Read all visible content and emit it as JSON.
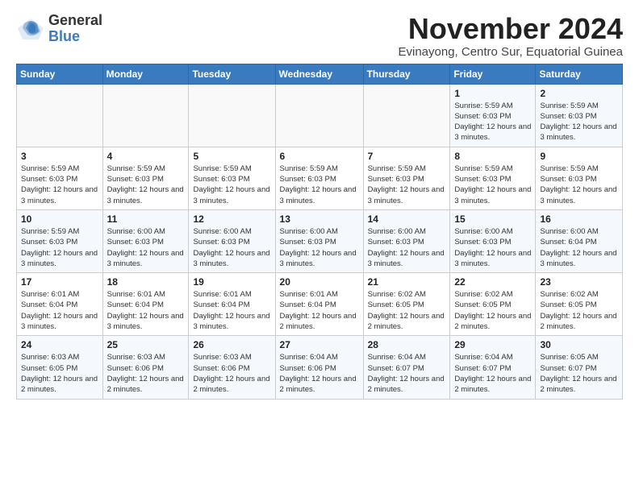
{
  "logo": {
    "general": "General",
    "blue": "Blue"
  },
  "header": {
    "month": "November 2024",
    "location": "Evinayong, Centro Sur, Equatorial Guinea"
  },
  "days_of_week": [
    "Sunday",
    "Monday",
    "Tuesday",
    "Wednesday",
    "Thursday",
    "Friday",
    "Saturday"
  ],
  "weeks": [
    [
      {
        "day": "",
        "info": ""
      },
      {
        "day": "",
        "info": ""
      },
      {
        "day": "",
        "info": ""
      },
      {
        "day": "",
        "info": ""
      },
      {
        "day": "",
        "info": ""
      },
      {
        "day": "1",
        "info": "Sunrise: 5:59 AM\nSunset: 6:03 PM\nDaylight: 12 hours and 3 minutes."
      },
      {
        "day": "2",
        "info": "Sunrise: 5:59 AM\nSunset: 6:03 PM\nDaylight: 12 hours and 3 minutes."
      }
    ],
    [
      {
        "day": "3",
        "info": "Sunrise: 5:59 AM\nSunset: 6:03 PM\nDaylight: 12 hours and 3 minutes."
      },
      {
        "day": "4",
        "info": "Sunrise: 5:59 AM\nSunset: 6:03 PM\nDaylight: 12 hours and 3 minutes."
      },
      {
        "day": "5",
        "info": "Sunrise: 5:59 AM\nSunset: 6:03 PM\nDaylight: 12 hours and 3 minutes."
      },
      {
        "day": "6",
        "info": "Sunrise: 5:59 AM\nSunset: 6:03 PM\nDaylight: 12 hours and 3 minutes."
      },
      {
        "day": "7",
        "info": "Sunrise: 5:59 AM\nSunset: 6:03 PM\nDaylight: 12 hours and 3 minutes."
      },
      {
        "day": "8",
        "info": "Sunrise: 5:59 AM\nSunset: 6:03 PM\nDaylight: 12 hours and 3 minutes."
      },
      {
        "day": "9",
        "info": "Sunrise: 5:59 AM\nSunset: 6:03 PM\nDaylight: 12 hours and 3 minutes."
      }
    ],
    [
      {
        "day": "10",
        "info": "Sunrise: 5:59 AM\nSunset: 6:03 PM\nDaylight: 12 hours and 3 minutes."
      },
      {
        "day": "11",
        "info": "Sunrise: 6:00 AM\nSunset: 6:03 PM\nDaylight: 12 hours and 3 minutes."
      },
      {
        "day": "12",
        "info": "Sunrise: 6:00 AM\nSunset: 6:03 PM\nDaylight: 12 hours and 3 minutes."
      },
      {
        "day": "13",
        "info": "Sunrise: 6:00 AM\nSunset: 6:03 PM\nDaylight: 12 hours and 3 minutes."
      },
      {
        "day": "14",
        "info": "Sunrise: 6:00 AM\nSunset: 6:03 PM\nDaylight: 12 hours and 3 minutes."
      },
      {
        "day": "15",
        "info": "Sunrise: 6:00 AM\nSunset: 6:03 PM\nDaylight: 12 hours and 3 minutes."
      },
      {
        "day": "16",
        "info": "Sunrise: 6:00 AM\nSunset: 6:04 PM\nDaylight: 12 hours and 3 minutes."
      }
    ],
    [
      {
        "day": "17",
        "info": "Sunrise: 6:01 AM\nSunset: 6:04 PM\nDaylight: 12 hours and 3 minutes."
      },
      {
        "day": "18",
        "info": "Sunrise: 6:01 AM\nSunset: 6:04 PM\nDaylight: 12 hours and 3 minutes."
      },
      {
        "day": "19",
        "info": "Sunrise: 6:01 AM\nSunset: 6:04 PM\nDaylight: 12 hours and 3 minutes."
      },
      {
        "day": "20",
        "info": "Sunrise: 6:01 AM\nSunset: 6:04 PM\nDaylight: 12 hours and 2 minutes."
      },
      {
        "day": "21",
        "info": "Sunrise: 6:02 AM\nSunset: 6:05 PM\nDaylight: 12 hours and 2 minutes."
      },
      {
        "day": "22",
        "info": "Sunrise: 6:02 AM\nSunset: 6:05 PM\nDaylight: 12 hours and 2 minutes."
      },
      {
        "day": "23",
        "info": "Sunrise: 6:02 AM\nSunset: 6:05 PM\nDaylight: 12 hours and 2 minutes."
      }
    ],
    [
      {
        "day": "24",
        "info": "Sunrise: 6:03 AM\nSunset: 6:05 PM\nDaylight: 12 hours and 2 minutes."
      },
      {
        "day": "25",
        "info": "Sunrise: 6:03 AM\nSunset: 6:06 PM\nDaylight: 12 hours and 2 minutes."
      },
      {
        "day": "26",
        "info": "Sunrise: 6:03 AM\nSunset: 6:06 PM\nDaylight: 12 hours and 2 minutes."
      },
      {
        "day": "27",
        "info": "Sunrise: 6:04 AM\nSunset: 6:06 PM\nDaylight: 12 hours and 2 minutes."
      },
      {
        "day": "28",
        "info": "Sunrise: 6:04 AM\nSunset: 6:07 PM\nDaylight: 12 hours and 2 minutes."
      },
      {
        "day": "29",
        "info": "Sunrise: 6:04 AM\nSunset: 6:07 PM\nDaylight: 12 hours and 2 minutes."
      },
      {
        "day": "30",
        "info": "Sunrise: 6:05 AM\nSunset: 6:07 PM\nDaylight: 12 hours and 2 minutes."
      }
    ]
  ]
}
